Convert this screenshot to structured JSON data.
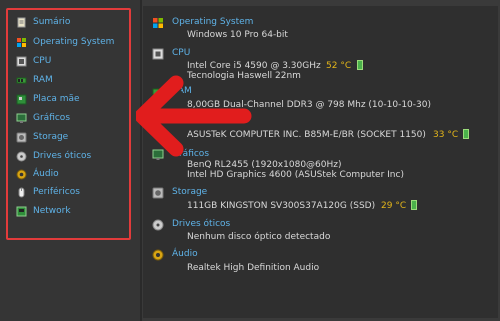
{
  "sidebar": {
    "items": [
      {
        "label": "Sumário",
        "icon": "summary-icon"
      },
      {
        "label": "Operating System",
        "icon": "windows-logo-icon"
      },
      {
        "label": "CPU",
        "icon": "cpu-icon"
      },
      {
        "label": "RAM",
        "icon": "ram-icon"
      },
      {
        "label": "Placa mãe",
        "icon": "motherboard-icon"
      },
      {
        "label": "Gráficos",
        "icon": "monitor-icon"
      },
      {
        "label": "Storage",
        "icon": "disk-icon"
      },
      {
        "label": "Drives óticos",
        "icon": "optical-drive-icon"
      },
      {
        "label": "Áudio",
        "icon": "speaker-icon"
      },
      {
        "label": "Periféricos",
        "icon": "mouse-icon"
      },
      {
        "label": "Network",
        "icon": "network-icon"
      }
    ]
  },
  "main": {
    "os": {
      "title": "Operating System",
      "line1": "Windows 10 Pro 64-bit"
    },
    "cpu": {
      "title": "CPU",
      "line1": "Intel Core i5 4590 @ 3.30GHz",
      "temp": "52 °C",
      "line2": "Tecnologia Haswell 22nm"
    },
    "ram": {
      "title": "RAM",
      "line1": "8,00GB Dual-Channel DDR3 @ 798 Mhz (10-10-10-30)"
    },
    "motherboard": {
      "line1": "ASUSTeK COMPUTER INC. B85M-E/BR (SOCKET 1150)",
      "temp": "33 °C"
    },
    "graphics": {
      "title": "Gráficos",
      "line1": "BenQ RL2455 (1920x1080@60Hz)",
      "line2": "Intel HD Graphics 4600 (ASUStek Computer Inc)"
    },
    "storage": {
      "title": "Storage",
      "line1": "111GB KINGSTON SV300S37A120G (SSD)",
      "temp": "29 °C"
    },
    "optical": {
      "title": "Drives óticos",
      "line1": "Nenhum disco óptico detectado"
    },
    "audio": {
      "title": "Áudio",
      "line1": "Realtek High Definition Audio"
    }
  },
  "colors": {
    "accent": "#5fb3e8",
    "highlight": "#e23b3b",
    "temp": "#e3b51a"
  }
}
